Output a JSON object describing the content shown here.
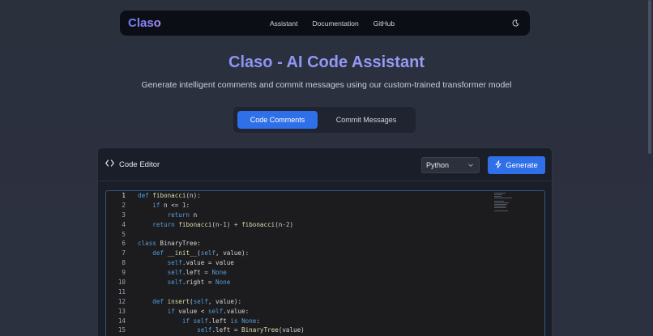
{
  "navbar": {
    "brand": "Claso",
    "links": [
      "Assistant",
      "Documentation",
      "GitHub"
    ],
    "theme_icon": "moon-icon"
  },
  "hero": {
    "title": "Claso - AI Code Assistant",
    "subtitle": "Generate intelligent comments and commit messages using our custom-trained transformer model"
  },
  "tabs": {
    "active": "Code Comments",
    "inactive": "Commit Messages"
  },
  "editor": {
    "label": "Code Editor",
    "label_icon": "code-brackets-icon",
    "language": "Python",
    "generate_label": "Generate",
    "generate_icon": "lightning-icon",
    "lines": [
      {
        "n": "1",
        "t": "def fibonacci(n):"
      },
      {
        "n": "2",
        "t": "    if n <= 1:"
      },
      {
        "n": "3",
        "t": "        return n"
      },
      {
        "n": "4",
        "t": "    return fibonacci(n-1) + fibonacci(n-2)"
      },
      {
        "n": "5",
        "t": ""
      },
      {
        "n": "6",
        "t": "class BinaryTree:"
      },
      {
        "n": "7",
        "t": "    def __init__(self, value):"
      },
      {
        "n": "8",
        "t": "        self.value = value"
      },
      {
        "n": "9",
        "t": "        self.left = None"
      },
      {
        "n": "10",
        "t": "        self.right = None"
      },
      {
        "n": "11",
        "t": ""
      },
      {
        "n": "12",
        "t": "    def insert(self, value):"
      },
      {
        "n": "13",
        "t": "        if value < self.value:"
      },
      {
        "n": "14",
        "t": "            if self.left is None:"
      },
      {
        "n": "15",
        "t": "                self.left = BinaryTree(value)"
      }
    ]
  },
  "colors": {
    "accent": "#2f6fe8",
    "brand_gradient_start": "#6d7cf5",
    "brand_gradient_end": "#a78bfa"
  }
}
